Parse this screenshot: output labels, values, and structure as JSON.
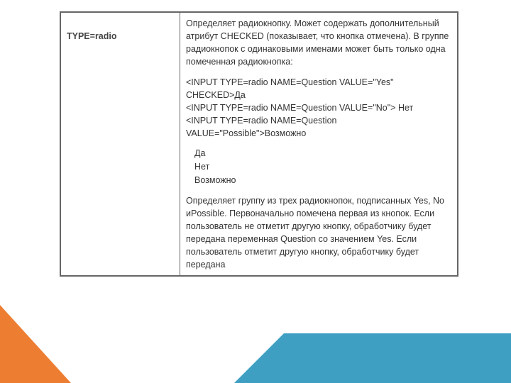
{
  "left_col": "TYPE=radio",
  "desc": "Определяет радиокнопку. Может содержать дополнительный\nатрибут CHECKED (показывает, что кнопка отмечена). В группе радиокнопок с одинаковыми именами может быть только одна помеченная радиокнопка:",
  "code_line1": "<INPUT TYPE=radio NAME=Question VALUE=\"Yes\" CHECKED>Да",
  "code_line2": "<INPUT TYPE=radio NAME=Question VALUE=\"No\"> Нет",
  "code_line3": "<INPUT TYPE=radio NAME=Question VALUE=\"Possible\">Возможно",
  "opt1": "Да",
  "opt2": "Нет",
  "opt3": "Возможно",
  "explain": "Определяет группу из трех радиокнопок, подписанных Yes, No иPossible. Первоначально помечена первая из кнопок. Если пользователь не отметит другую кнопку, обработчику будет передана переменная Question со значением Yes. Если пользователь отметит другую кнопку, обработчику будет передана"
}
